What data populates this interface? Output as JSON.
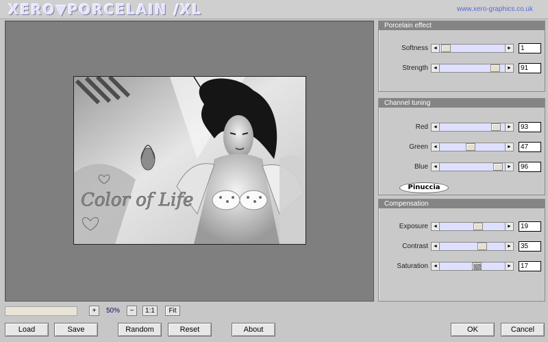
{
  "app": {
    "brand": "XERO▼PORCELAIN /XL",
    "url": "www.xero-graphics.co.uk"
  },
  "panels": {
    "porcelain": {
      "title": "Porcelain effect",
      "rows": [
        {
          "label": "Softness",
          "value": "1",
          "fraction": 0.02
        },
        {
          "label": "Strength",
          "value": "91",
          "fraction": 0.91
        }
      ]
    },
    "channel": {
      "title": "Channel tuning",
      "rows": [
        {
          "label": "Red",
          "value": "93",
          "fraction": 0.93
        },
        {
          "label": "Green",
          "value": "47",
          "fraction": 0.47
        },
        {
          "label": "Blue",
          "value": "96",
          "fraction": 0.96
        }
      ],
      "signature": "Pinuccia"
    },
    "compensation": {
      "title": "Compensation",
      "rows": [
        {
          "label": "Exposure",
          "value": "19",
          "fraction": 0.6
        },
        {
          "label": "Contrast",
          "value": "35",
          "fraction": 0.68
        },
        {
          "label": "Saturation",
          "value": "17",
          "fraction": 0.58
        }
      ]
    }
  },
  "zoom": {
    "plus": "+",
    "value": "50%",
    "minus": "−",
    "one_to_one": "1:1",
    "fit": "Fit"
  },
  "buttons": {
    "load": "Load",
    "save": "Save",
    "random": "Random",
    "reset": "Reset",
    "about": "About",
    "ok": "OK",
    "cancel": "Cancel"
  },
  "icons": {
    "slider_left": "◄",
    "slider_right": "►"
  },
  "photo": {
    "watermark": "Color of Life"
  },
  "colors": {
    "slider_track": "#dfe0ff",
    "panel_header": "#848484",
    "url": "#5a6ad8"
  }
}
